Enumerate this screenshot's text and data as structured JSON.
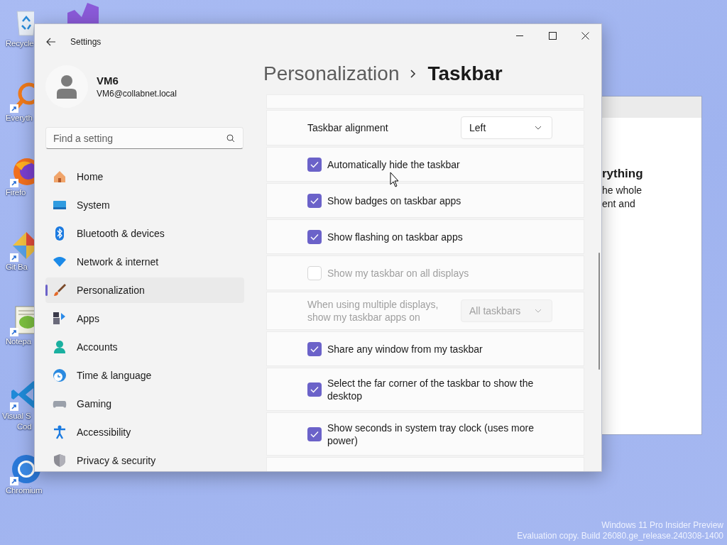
{
  "desktop": {
    "icons": [
      {
        "lines": [
          "Recycle"
        ]
      },
      {
        "lines": [
          "Everyth"
        ]
      },
      {
        "lines": [
          "Firefo"
        ]
      },
      {
        "lines": [
          "Git Ba"
        ]
      },
      {
        "lines": [
          "Notepa"
        ]
      },
      {
        "lines": [
          "Visual S",
          "Cod"
        ]
      },
      {
        "lines": [
          "Chromium"
        ]
      }
    ],
    "watermark": [
      "Windows 11 Pro Insider Preview",
      "Evaluation copy. Build 26080.ge_release.240308-1400"
    ]
  },
  "background_window": {
    "lines": [
      {
        "kind": "heading",
        "text": "rything"
      },
      {
        "kind": "body",
        "text": "he whole"
      },
      {
        "kind": "body",
        "text": "ent and"
      }
    ]
  },
  "settings": {
    "title": "Settings",
    "user": {
      "name": "VM6",
      "email": "VM6@collabnet.local"
    },
    "search": {
      "placeholder": "Find a setting"
    },
    "nav": [
      {
        "label": "Home",
        "selected": false
      },
      {
        "label": "System",
        "selected": false
      },
      {
        "label": "Bluetooth & devices",
        "selected": false
      },
      {
        "label": "Network & internet",
        "selected": false
      },
      {
        "label": "Personalization",
        "selected": true
      },
      {
        "label": "Apps",
        "selected": false
      },
      {
        "label": "Accounts",
        "selected": false
      },
      {
        "label": "Time & language",
        "selected": false
      },
      {
        "label": "Gaming",
        "selected": false
      },
      {
        "label": "Accessibility",
        "selected": false
      },
      {
        "label": "Privacy & security",
        "selected": false
      }
    ],
    "breadcrumb": [
      "Personalization",
      "Taskbar"
    ],
    "rows": [
      {
        "kind": "dropdown",
        "label": "Taskbar alignment",
        "value": "Left",
        "disabled": false
      },
      {
        "kind": "checkbox",
        "label": "Automatically hide the taskbar",
        "checked": true,
        "disabled": false
      },
      {
        "kind": "checkbox",
        "label": "Show badges on taskbar apps",
        "checked": true,
        "disabled": false
      },
      {
        "kind": "checkbox",
        "label": "Show flashing on taskbar apps",
        "checked": true,
        "disabled": false
      },
      {
        "kind": "checkbox",
        "label": "Show my taskbar on all displays",
        "checked": false,
        "disabled": true
      },
      {
        "kind": "dropdown",
        "label": "When using multiple displays, show my taskbar apps on",
        "value": "All taskbars",
        "disabled": true
      },
      {
        "kind": "checkbox",
        "label": "Share any window from my taskbar",
        "checked": true,
        "disabled": false
      },
      {
        "kind": "checkbox",
        "label": "Select the far corner of the taskbar to show the desktop",
        "checked": true,
        "disabled": false
      },
      {
        "kind": "checkbox",
        "label": "Show seconds in system tray clock (uses more power)",
        "checked": true,
        "disabled": false
      }
    ]
  }
}
